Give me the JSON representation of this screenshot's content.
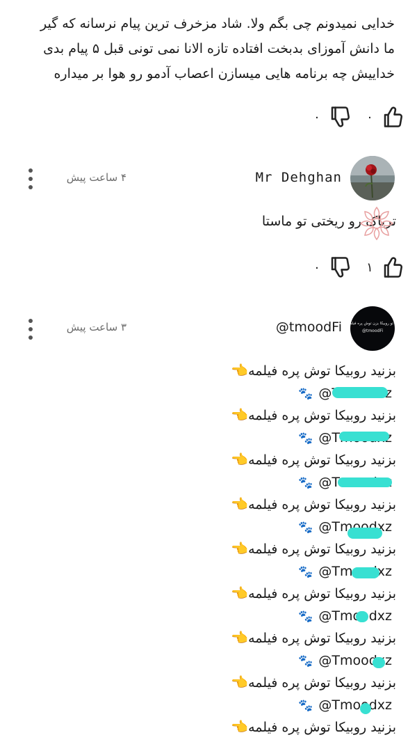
{
  "comments": [
    {
      "partial": true,
      "lines": [
        "خدایی نمیدونم چی بگم ولا. شاد مزخرف ترین پیام نرسانه که گیر",
        "ما دانش آموزای بدبخت افتاده تازه الانا نمی تونی قبل ۵ پیام بدی",
        "خداییش چه برنامه هایی میسازن اعصاب آدمو رو هوا بر میداره"
      ],
      "likes": "۰",
      "dislikes": "۰"
    },
    {
      "author": "Mr Dehghan",
      "time": "۴ ساعت پیش",
      "text": "تریاک رو ریختی تو ماستا",
      "likes": "۱",
      "dislikes": "۰"
    },
    {
      "author": "@tmoodFi",
      "avatar_text_line1": "تو روبیکا بزن توش پره فیلمه",
      "avatar_text_line2": "@tmoodFi",
      "time": "۳ ساعت پیش",
      "spam_text": "بزنید روبیکا توش پره فیلمه",
      "handles": [
        "@Tmoodxz",
        "@Tmoodxz",
        "@Tmoodxz",
        "@Tmoodxz",
        "@Tmoodxz",
        "@Tmoodxz",
        "@Tmoodxz",
        "@Tmoodxz"
      ]
    }
  ],
  "icons": {
    "like": "thumbs-up-icon",
    "dislike": "thumbs-down-icon",
    "more": "more-vertical-icon",
    "pointing": "pointing-left-emoji",
    "paw": "paw-prints-emoji"
  },
  "colors": {
    "marker": "#38e0d2",
    "text": "#1a1a1a",
    "muted": "#6b6b6b"
  }
}
